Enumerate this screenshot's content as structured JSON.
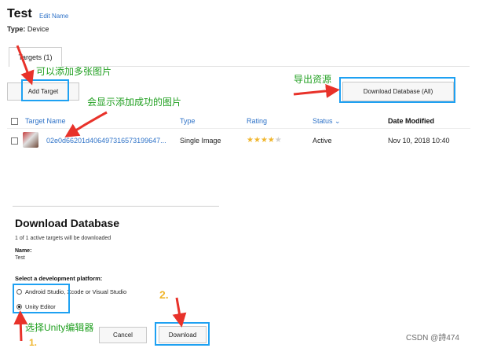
{
  "header": {
    "title": "Test",
    "edit_name": "Edit Name",
    "type_label": "Type:",
    "type_value": "Device"
  },
  "tabs": [
    {
      "label": "Targets (1)"
    }
  ],
  "toolbar": {
    "add_target": "Add Target",
    "download_database_all": "Download Database (All)"
  },
  "table": {
    "columns": [
      "Target Name",
      "Type",
      "Rating",
      "Status",
      "Date Modified"
    ],
    "status_caret": "⌄",
    "rows": [
      {
        "target_name": "02e0d66201d406497316573199647...",
        "type": "Single Image",
        "rating": 4,
        "rating_max": 5,
        "status": "Active",
        "date_modified": "Nov 10, 2018 10:40"
      }
    ]
  },
  "annotations": {
    "add_multiple_images": "可以添加多张图片",
    "export_resources": "导出资源",
    "shows_added_images": "会显示添加成功的图片",
    "select_unity_editor": "选择Unity编辑器",
    "step_2": "2.",
    "step_1": "1."
  },
  "download_dialog": {
    "title": "Download Database",
    "note": "1 of 1 active targets will be downloaded",
    "name_label": "Name:",
    "name_value": "Test",
    "platform_label": "Select a development platform:",
    "options": [
      {
        "label": "Android Studio, Xcode or Visual Studio",
        "selected": false
      },
      {
        "label": "Unity Editor",
        "selected": true
      }
    ],
    "cancel": "Cancel",
    "download": "Download"
  },
  "watermark": "CSDN @詩474",
  "colors": {
    "link_blue": "#2f73c8",
    "highlight_blue": "#1ea1f2",
    "annotation_green": "#22a022",
    "annotation_arrow_red": "#e8322a",
    "step_yellow": "#f0b62e",
    "star_gold": "#f0b62e"
  }
}
